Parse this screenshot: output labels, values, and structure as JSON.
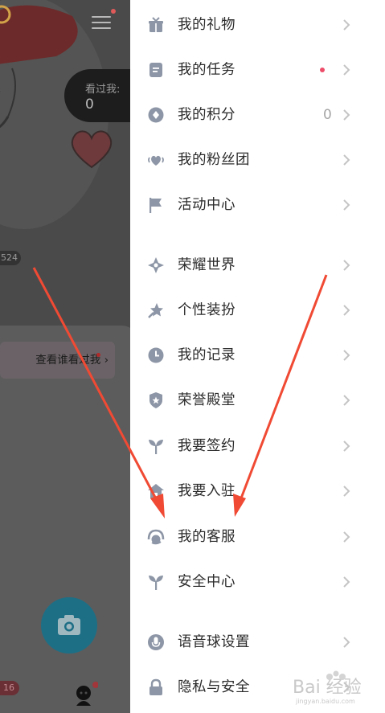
{
  "profile": {
    "seen_label": "看过我:",
    "seen_count": "0",
    "badge_text": "524",
    "view_visitors_label": "查看谁看过我",
    "nav_badge": "16"
  },
  "drawer": {
    "items": [
      {
        "label": "我的礼物",
        "icon": "gift-icon"
      },
      {
        "label": "我的任务",
        "icon": "task-icon",
        "red_dot": true
      },
      {
        "label": "我的积分",
        "icon": "points-icon",
        "value": "0"
      },
      {
        "label": "我的粉丝团",
        "icon": "fan-club-icon"
      },
      {
        "label": "活动中心",
        "icon": "flag-icon"
      },
      {
        "label": "荣耀世界",
        "icon": "compass-icon"
      },
      {
        "label": "个性装扮",
        "icon": "star-dress-icon"
      },
      {
        "label": "我的记录",
        "icon": "clock-icon"
      },
      {
        "label": "荣誉殿堂",
        "icon": "shield-star-icon"
      },
      {
        "label": "我要签约",
        "icon": "sprout-icon"
      },
      {
        "label": "我要入驻",
        "icon": "house-icon"
      },
      {
        "label": "我的客服",
        "icon": "headset-icon"
      },
      {
        "label": "安全中心",
        "icon": "sprout-icon"
      },
      {
        "label": "语音球设置",
        "icon": "microphone-icon"
      },
      {
        "label": "隐私与安全",
        "icon": "lock-icon"
      }
    ]
  },
  "colors": {
    "icon": "#8d96a6",
    "chevron": "#c4c4c4",
    "red_dot": "#ee4d6a",
    "arrow": "#f04a34"
  },
  "watermark": {
    "brand": "Bai 经验",
    "url": "jingyan.baidu.com"
  }
}
